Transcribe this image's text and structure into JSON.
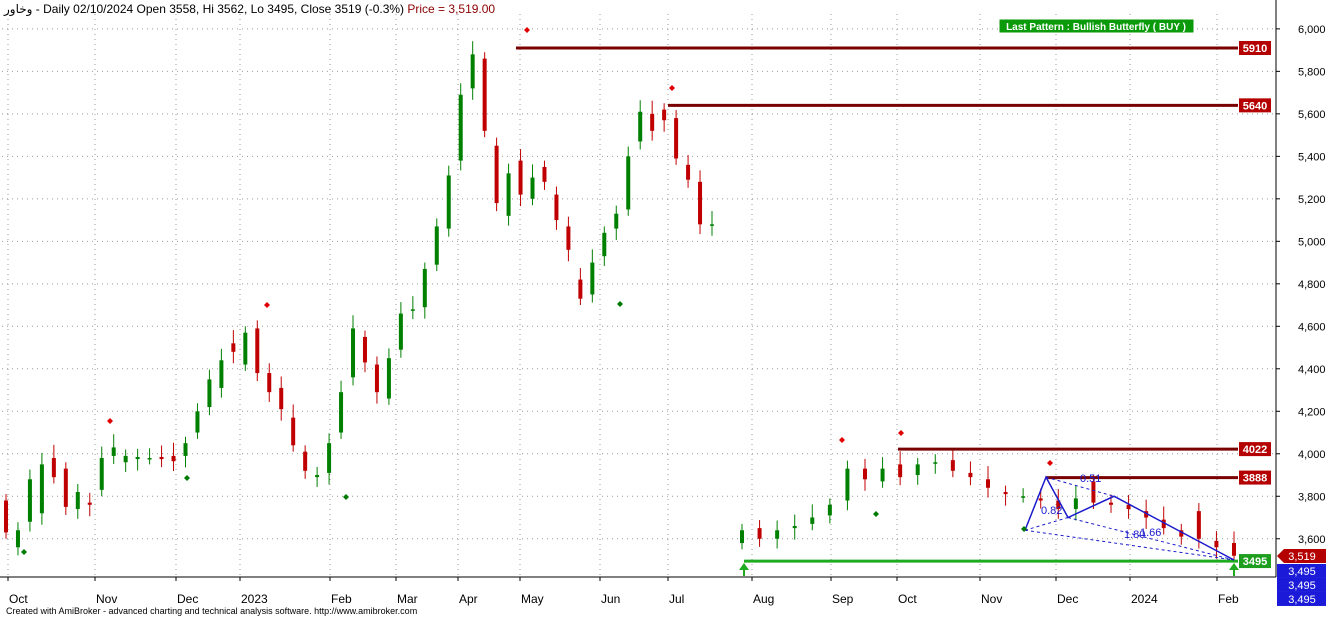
{
  "header": {
    "symbol": "وخاور",
    "info": " - Daily 02/10/2024 Open 3558, Hi 3562, Lo 3495, Close 3519 (-0.3%)",
    "price": " Price = 3,519.00"
  },
  "footer": {
    "text": "Created with AmiBroker - advanced charting and technical analysis software. http://www.amibroker.com"
  },
  "pattern_label": "Last Pattern : Bullish Butterfly ( BUY )",
  "colors": {
    "up": "#008000",
    "down": "#c00000",
    "resistance": "#7a0000",
    "support": "#1faa1f",
    "pattern": "#1a1acc",
    "label_red_bg": "#b40000",
    "label_blue_bg": "#1a1ad8"
  },
  "chart_data": {
    "type": "candlestick",
    "y_axis": {
      "ylim": [
        3420,
        6070
      ],
      "ticks": [
        "6,000",
        "5,800",
        "5,600",
        "5,400",
        "5,200",
        "5,000",
        "4,800",
        "4,600",
        "4,400",
        "4,200",
        "4,000",
        "3,800",
        "3,600"
      ]
    },
    "x_axis": {
      "tick_labels": [
        "Oct",
        "Nov",
        "Dec",
        "2023",
        "Feb",
        "Mar",
        "Apr",
        "May",
        "Jun",
        "Jul",
        "Aug",
        "Sep",
        "Oct",
        "Nov",
        "Dec",
        "2024",
        "Feb"
      ]
    },
    "series": [
      {
        "values": [
          [
            3780,
            3630
          ],
          [
            3560,
            3640
          ],
          [
            3680,
            3880
          ],
          [
            3720,
            3950
          ],
          [
            3980,
            3890
          ],
          [
            3930,
            3750
          ],
          [
            3740,
            3820
          ],
          [
            3770,
            3760
          ],
          [
            3830,
            3980
          ],
          [
            3990,
            4030
          ],
          [
            3960,
            3990
          ],
          [
            3975,
            3985
          ],
          [
            3980,
            3980
          ],
          [
            3985,
            3975
          ],
          [
            3990,
            3965
          ],
          [
            3990,
            4050
          ],
          [
            4100,
            4200
          ],
          [
            4220,
            4350
          ],
          [
            4310,
            4440
          ],
          [
            4520,
            4480
          ],
          [
            4420,
            4570
          ],
          [
            4590,
            4380
          ],
          [
            4380,
            4290
          ],
          [
            4310,
            4210
          ],
          [
            4170,
            4040
          ],
          [
            4010,
            3920
          ],
          [
            3890,
            3900
          ],
          [
            3910,
            4050
          ],
          [
            4100,
            4290
          ],
          [
            4360,
            4590
          ],
          [
            4550,
            4430
          ],
          [
            4420,
            4290
          ],
          [
            4260,
            4450
          ],
          [
            4490,
            4660
          ],
          [
            4680,
            4680
          ],
          [
            4690,
            4870
          ],
          [
            4890,
            5070
          ],
          [
            5060,
            5310
          ],
          [
            5380,
            5690
          ],
          [
            5720,
            5880
          ],
          [
            5860,
            5520
          ],
          [
            5450,
            5180
          ],
          [
            5120,
            5320
          ],
          [
            5380,
            5220
          ],
          [
            5200,
            5300
          ],
          [
            5350,
            5280
          ],
          [
            5220,
            5100
          ],
          [
            5070,
            4960
          ],
          [
            4820,
            4730
          ],
          [
            4750,
            4900
          ],
          [
            4930,
            5040
          ],
          [
            5060,
            5130
          ],
          [
            5150,
            5400
          ],
          [
            5470,
            5610
          ],
          [
            5600,
            5520
          ],
          [
            5620,
            5570
          ],
          [
            5580,
            5390
          ],
          [
            5360,
            5290
          ],
          [
            5280,
            5080
          ],
          [
            5080,
            5080
          ],
          [
            3580,
            3640
          ],
          [
            3650,
            3600
          ],
          [
            3600,
            3640
          ],
          [
            3650,
            3660
          ],
          [
            3670,
            3700
          ],
          [
            3710,
            3760
          ],
          [
            3780,
            3930
          ],
          [
            3930,
            3880
          ],
          [
            3870,
            3930
          ],
          [
            3950,
            3890
          ],
          [
            3900,
            3950
          ],
          [
            3960,
            3960
          ],
          [
            3970,
            3920
          ],
          [
            3910,
            3890
          ],
          [
            3880,
            3840
          ],
          [
            3820,
            3810
          ],
          [
            3800,
            3800
          ],
          [
            3790,
            3780
          ],
          [
            3780,
            3740
          ],
          [
            3740,
            3790
          ],
          [
            3870,
            3770
          ],
          [
            3770,
            3760
          ],
          [
            3760,
            3740
          ],
          [
            3730,
            3700
          ],
          [
            3690,
            3650
          ],
          [
            3640,
            3610
          ],
          [
            3730,
            3600
          ],
          [
            3590,
            3560
          ],
          [
            3580,
            3520
          ]
        ]
      }
    ],
    "levels": [
      {
        "value": 5910,
        "label": "5910"
      },
      {
        "value": 5640,
        "label": "5640"
      },
      {
        "value": 4022,
        "label": "4022"
      },
      {
        "value": 3888,
        "label": "3888"
      },
      {
        "value": 3495,
        "label": "3495"
      }
    ],
    "pattern": {
      "name": "Bullish Butterfly",
      "points": [
        [
          3640
        ],
        [
          3890
        ],
        [
          3700
        ],
        [
          3800
        ],
        [
          3500
        ]
      ],
      "ratios": [
        "0.51",
        "0.82",
        "1.66",
        "1.80"
      ]
    },
    "last_price": {
      "label": "3,519",
      "value": 3519
    },
    "stacked_labels": [
      "3,495",
      "3,495",
      "3,495"
    ]
  }
}
